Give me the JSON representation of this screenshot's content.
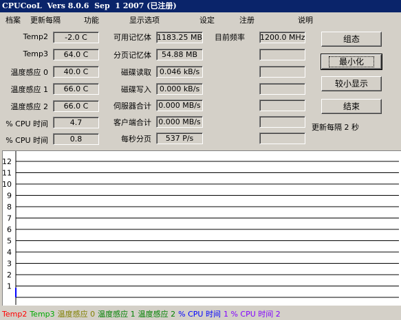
{
  "window": {
    "title": "CPUCooL  Vers 8.0.6  Sep  1 2007 (已注册)"
  },
  "menu": [
    "档案",
    "更新每隔",
    "功能",
    "显示选项",
    "设定",
    "注册",
    "说明"
  ],
  "col1": {
    "rows": [
      {
        "label": "Temp2",
        "value": "-2.0 C"
      },
      {
        "label": "Temp3",
        "value": "64.0 C"
      },
      {
        "label": "温度感应 0",
        "value": "40.0 C"
      },
      {
        "label": "温度感应 1",
        "value": "66.0 C"
      },
      {
        "label": "温度感应 2",
        "value": "66.0 C"
      },
      {
        "label": "% CPU 时间",
        "value": "4.7"
      },
      {
        "label": "% CPU 时间",
        "value": "0.8"
      }
    ]
  },
  "col2": {
    "rows": [
      {
        "label": "可用记忆体",
        "value": "1183.25 MB"
      },
      {
        "label": "分页记忆体",
        "value": "54.88 MB"
      },
      {
        "label": "磁碟读取",
        "value": "0.046 kB/s"
      },
      {
        "label": "磁碟写入",
        "value": "0.000 kB/s"
      },
      {
        "label": "伺服器合计",
        "value": "0.000 MB/s"
      },
      {
        "label": "客户端合计",
        "value": "0.000 MB/s"
      },
      {
        "label": "每秒分页",
        "value": "537 P/s"
      }
    ]
  },
  "col3": {
    "label": "目前频率",
    "values": [
      "1200.0 MHz",
      "",
      "",
      "",
      "",
      "",
      ""
    ]
  },
  "buttons": {
    "config": "组态",
    "minimize": "最小化",
    "small": "较小显示",
    "exit": "结束"
  },
  "update_text": "更新每隔 2 秒",
  "graph": {
    "y_ticks": [
      "12",
      "11",
      "10",
      "9",
      "8",
      "7",
      "6",
      "5",
      "4",
      "3",
      "2",
      "1"
    ]
  },
  "legend": [
    {
      "text": "Temp2",
      "color": "#ff0000"
    },
    {
      "text": "Temp3",
      "color": "#00aa00"
    },
    {
      "text": "温度感应 0",
      "color": "#808000"
    },
    {
      "text": "温度感应 1",
      "color": "#008000"
    },
    {
      "text": "温度感应 2",
      "color": "#008000"
    },
    {
      "text": "% CPU 时间",
      "color": "#0000ff"
    },
    {
      "text": "1 % CPU 时间 2",
      "color": "#8000ff"
    }
  ]
}
